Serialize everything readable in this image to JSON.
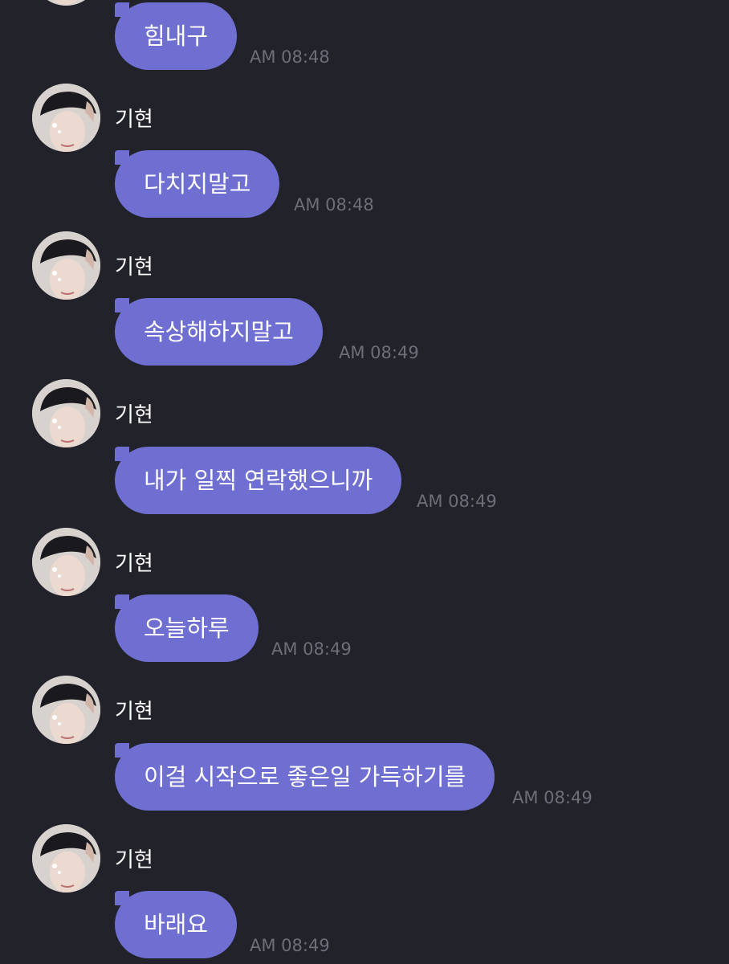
{
  "sender_name": "기현",
  "messages": [
    {
      "text": "힘내구",
      "time": "AM 08:48"
    },
    {
      "text": "다치지말고",
      "time": "AM 08:48"
    },
    {
      "text": "속상해하지말고",
      "time": "AM 08:49"
    },
    {
      "text": "내가 일찍 연락했으니까",
      "time": "AM 08:49"
    },
    {
      "text": "오늘하루",
      "time": "AM 08:49"
    },
    {
      "text": "이걸 시작으로 좋은일 가득하기를",
      "time": "AM 08:49"
    },
    {
      "text": "바래요",
      "time": "AM 08:49"
    }
  ],
  "colors": {
    "background": "#22222a",
    "bubble": "#6f6fd2",
    "timestamp": "#6e6e78"
  }
}
